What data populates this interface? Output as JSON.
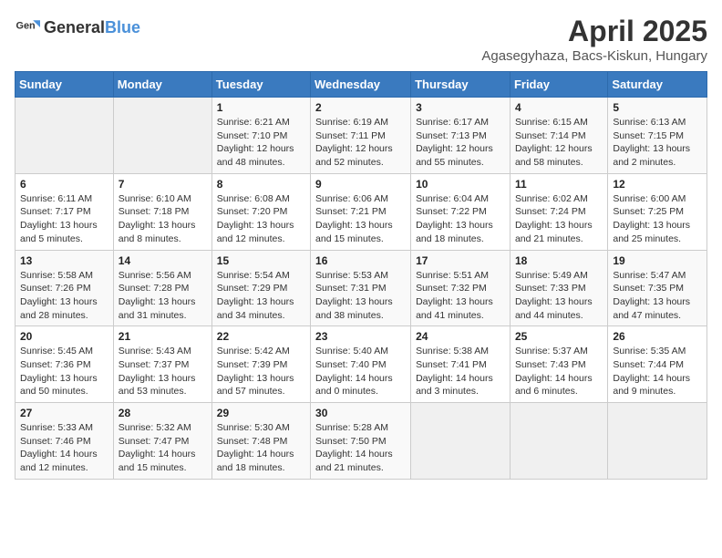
{
  "header": {
    "logo_general": "General",
    "logo_blue": "Blue",
    "title": "April 2025",
    "subtitle": "Agasegyhaza, Bacs-Kiskun, Hungary"
  },
  "weekdays": [
    "Sunday",
    "Monday",
    "Tuesday",
    "Wednesday",
    "Thursday",
    "Friday",
    "Saturday"
  ],
  "weeks": [
    [
      {
        "day": "",
        "info": ""
      },
      {
        "day": "",
        "info": ""
      },
      {
        "day": "1",
        "info": "Sunrise: 6:21 AM\nSunset: 7:10 PM\nDaylight: 12 hours and 48 minutes."
      },
      {
        "day": "2",
        "info": "Sunrise: 6:19 AM\nSunset: 7:11 PM\nDaylight: 12 hours and 52 minutes."
      },
      {
        "day": "3",
        "info": "Sunrise: 6:17 AM\nSunset: 7:13 PM\nDaylight: 12 hours and 55 minutes."
      },
      {
        "day": "4",
        "info": "Sunrise: 6:15 AM\nSunset: 7:14 PM\nDaylight: 12 hours and 58 minutes."
      },
      {
        "day": "5",
        "info": "Sunrise: 6:13 AM\nSunset: 7:15 PM\nDaylight: 13 hours and 2 minutes."
      }
    ],
    [
      {
        "day": "6",
        "info": "Sunrise: 6:11 AM\nSunset: 7:17 PM\nDaylight: 13 hours and 5 minutes."
      },
      {
        "day": "7",
        "info": "Sunrise: 6:10 AM\nSunset: 7:18 PM\nDaylight: 13 hours and 8 minutes."
      },
      {
        "day": "8",
        "info": "Sunrise: 6:08 AM\nSunset: 7:20 PM\nDaylight: 13 hours and 12 minutes."
      },
      {
        "day": "9",
        "info": "Sunrise: 6:06 AM\nSunset: 7:21 PM\nDaylight: 13 hours and 15 minutes."
      },
      {
        "day": "10",
        "info": "Sunrise: 6:04 AM\nSunset: 7:22 PM\nDaylight: 13 hours and 18 minutes."
      },
      {
        "day": "11",
        "info": "Sunrise: 6:02 AM\nSunset: 7:24 PM\nDaylight: 13 hours and 21 minutes."
      },
      {
        "day": "12",
        "info": "Sunrise: 6:00 AM\nSunset: 7:25 PM\nDaylight: 13 hours and 25 minutes."
      }
    ],
    [
      {
        "day": "13",
        "info": "Sunrise: 5:58 AM\nSunset: 7:26 PM\nDaylight: 13 hours and 28 minutes."
      },
      {
        "day": "14",
        "info": "Sunrise: 5:56 AM\nSunset: 7:28 PM\nDaylight: 13 hours and 31 minutes."
      },
      {
        "day": "15",
        "info": "Sunrise: 5:54 AM\nSunset: 7:29 PM\nDaylight: 13 hours and 34 minutes."
      },
      {
        "day": "16",
        "info": "Sunrise: 5:53 AM\nSunset: 7:31 PM\nDaylight: 13 hours and 38 minutes."
      },
      {
        "day": "17",
        "info": "Sunrise: 5:51 AM\nSunset: 7:32 PM\nDaylight: 13 hours and 41 minutes."
      },
      {
        "day": "18",
        "info": "Sunrise: 5:49 AM\nSunset: 7:33 PM\nDaylight: 13 hours and 44 minutes."
      },
      {
        "day": "19",
        "info": "Sunrise: 5:47 AM\nSunset: 7:35 PM\nDaylight: 13 hours and 47 minutes."
      }
    ],
    [
      {
        "day": "20",
        "info": "Sunrise: 5:45 AM\nSunset: 7:36 PM\nDaylight: 13 hours and 50 minutes."
      },
      {
        "day": "21",
        "info": "Sunrise: 5:43 AM\nSunset: 7:37 PM\nDaylight: 13 hours and 53 minutes."
      },
      {
        "day": "22",
        "info": "Sunrise: 5:42 AM\nSunset: 7:39 PM\nDaylight: 13 hours and 57 minutes."
      },
      {
        "day": "23",
        "info": "Sunrise: 5:40 AM\nSunset: 7:40 PM\nDaylight: 14 hours and 0 minutes."
      },
      {
        "day": "24",
        "info": "Sunrise: 5:38 AM\nSunset: 7:41 PM\nDaylight: 14 hours and 3 minutes."
      },
      {
        "day": "25",
        "info": "Sunrise: 5:37 AM\nSunset: 7:43 PM\nDaylight: 14 hours and 6 minutes."
      },
      {
        "day": "26",
        "info": "Sunrise: 5:35 AM\nSunset: 7:44 PM\nDaylight: 14 hours and 9 minutes."
      }
    ],
    [
      {
        "day": "27",
        "info": "Sunrise: 5:33 AM\nSunset: 7:46 PM\nDaylight: 14 hours and 12 minutes."
      },
      {
        "day": "28",
        "info": "Sunrise: 5:32 AM\nSunset: 7:47 PM\nDaylight: 14 hours and 15 minutes."
      },
      {
        "day": "29",
        "info": "Sunrise: 5:30 AM\nSunset: 7:48 PM\nDaylight: 14 hours and 18 minutes."
      },
      {
        "day": "30",
        "info": "Sunrise: 5:28 AM\nSunset: 7:50 PM\nDaylight: 14 hours and 21 minutes."
      },
      {
        "day": "",
        "info": ""
      },
      {
        "day": "",
        "info": ""
      },
      {
        "day": "",
        "info": ""
      }
    ]
  ]
}
